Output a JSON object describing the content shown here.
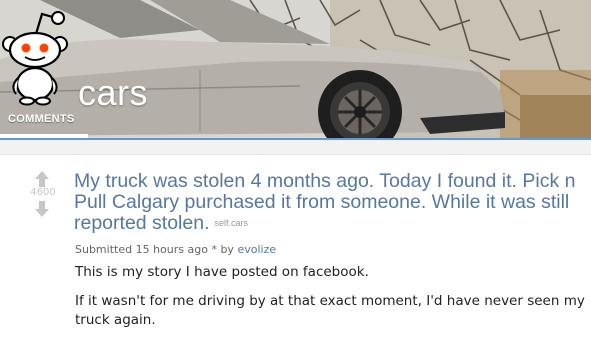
{
  "header": {
    "subreddit": "cars",
    "tab_comments": "COMMENTS"
  },
  "post": {
    "score": "4600",
    "title": "My truck was stolen 4 months ago. Today I found it. Pick n Pull Calgary purchased it from someone. While it was still reported stolen.",
    "domain": "self.cars",
    "tagline_prefix": "Submitted 15 hours ago",
    "tagline_star": "*",
    "tagline_by": "by",
    "author": "evolize",
    "paragraphs": [
      "This is my story I have posted on facebook.",
      "If it wasn't for me driving by at that exact moment, I'd have never seen my truck again."
    ]
  },
  "colors": {
    "link": "#5678a0",
    "accent_blue": "#5f99cf",
    "score_gray": "#c6c6c6"
  },
  "icons": {
    "mascot": "reddit-alien-icon",
    "upvote": "upvote-arrow-icon",
    "downvote": "downvote-arrow-icon"
  }
}
